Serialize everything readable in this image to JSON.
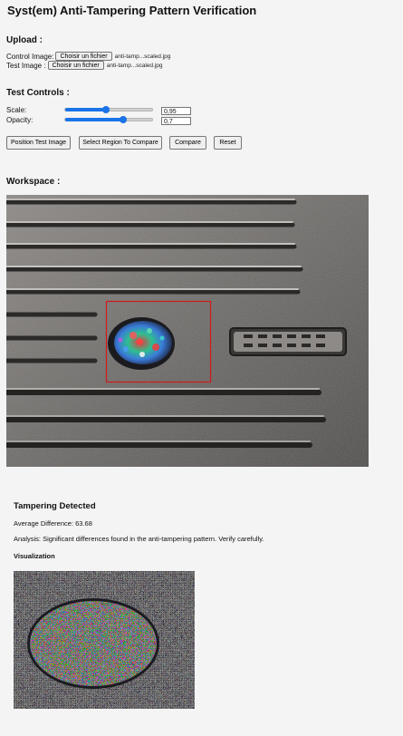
{
  "title": "Syst(em) Anti-Tampering Pattern Verification",
  "upload": {
    "heading": "Upload :",
    "control": {
      "label": "Control Image:",
      "button": "Choisir un fichier",
      "filename": "anti-tamp...scaled.jpg"
    },
    "test": {
      "label": "Test Image :",
      "button": "Choisir un fichier",
      "filename": "anti-tamp...scaled.jpg"
    }
  },
  "controls": {
    "heading": "Test Controls :",
    "scale": {
      "label": "Scale:",
      "value": "0,95",
      "level": 0.47
    },
    "opacity": {
      "label": "Opacity:",
      "value": "0,7",
      "level": 0.67
    }
  },
  "buttons": {
    "position": "Position Test Image",
    "select_region": "Select Region To Compare",
    "compare": "Compare",
    "reset": "Reset"
  },
  "workspace": {
    "heading": "Workspace :"
  },
  "result": {
    "title": "Tampering Detected",
    "average": "Average Difference: 63.68",
    "analysis": "Analysis: Significant differences found in the anti-tampering pattern. Verify carefully.",
    "viz_heading": "Visualization"
  },
  "colors": {
    "accent": "#1a73e8",
    "selection": "#d11a1a"
  }
}
